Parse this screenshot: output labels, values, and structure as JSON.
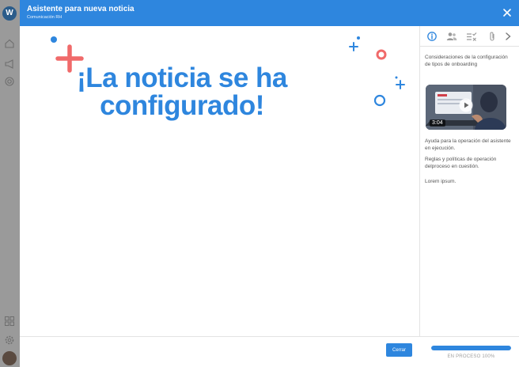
{
  "app": {
    "logo_letter": "W"
  },
  "header": {
    "title": "Asistente para nueva noticia",
    "subtitle": "Comunicación RH"
  },
  "main": {
    "headline_line1": "¡La noticia se ha",
    "headline_line2": "configurado!"
  },
  "panel": {
    "tabs": [
      "info-icon",
      "users-icon",
      "checklist-icon",
      "attachment-icon",
      "chevron-right-icon"
    ],
    "intro": "Consideraciones de la configuración de tipos de onboarding",
    "video_duration": "3:04",
    "paragraphs": [
      "Ayuda para la operación del asistente en ejecución.",
      "Reglas y políticas de operación delproceso en cuestión.",
      "Lorem ipsum."
    ]
  },
  "footer": {
    "close_label": "Cerrar",
    "progress_value": 1.0,
    "progress_label": "EN PROCESO 100%"
  },
  "colors": {
    "accent": "#2e86de",
    "coral": "#f06a6a"
  }
}
